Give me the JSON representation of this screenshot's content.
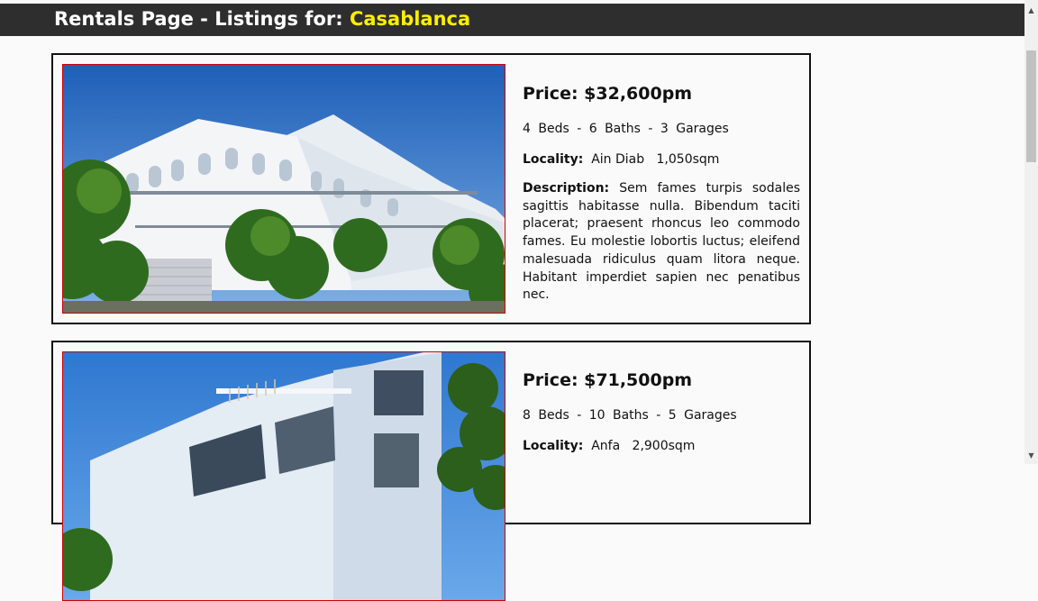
{
  "header": {
    "title_prefix": "Rentals Page - Listings for: ",
    "city": "Casablanca"
  },
  "labels": {
    "locality": "Locality:",
    "description": "Description:"
  },
  "listings": [
    {
      "price": "Price: $32,600pm",
      "specs": "4 Beds  -  6 Baths  -  3 Garages",
      "locality": "Ain Diab",
      "area": "1,050sqm",
      "description": "Sem fames turpis sodales sagittis habitasse nulla. Bibendum taciti placerat; praesent rhoncus leo commodo fames. Eu molestie lobortis luctus; eleifend malesuada ridiculus quam litora neque. Habitant imperdiet sapien nec penatibus nec."
    },
    {
      "price": "Price: $71,500pm",
      "specs": "8 Beds  -  10 Baths  -  5 Garages",
      "locality": "Anfa",
      "area": "2,900sqm",
      "description": ""
    }
  ],
  "colors": {
    "header_bg": "#2e2e2e",
    "city_accent": "#ffee00",
    "photo_border": "#d40000"
  }
}
